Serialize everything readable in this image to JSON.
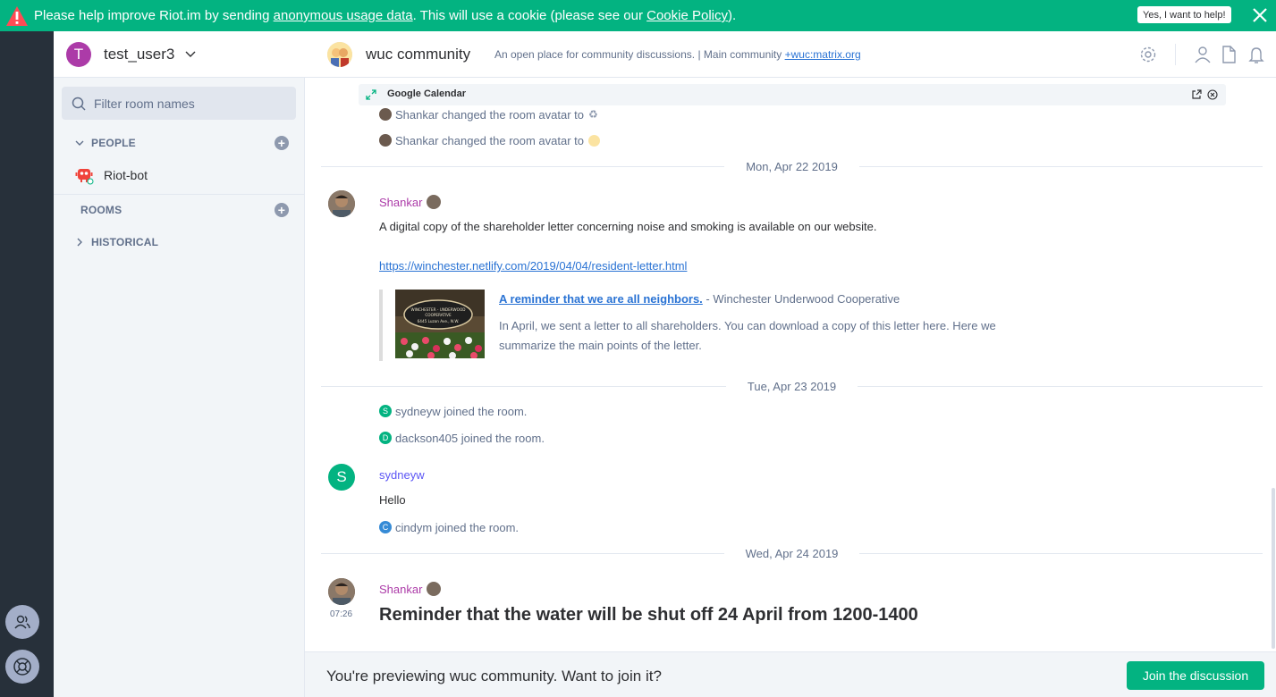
{
  "banner": {
    "prefix": "Please help improve Riot.im by sending ",
    "link1": "anonymous usage data",
    "middle": ". This will use a cookie (please see our ",
    "link2": "Cookie Policy",
    "suffix": ").",
    "yes_label": "Yes, I want to help!",
    "bg_color": "#03b381"
  },
  "user": {
    "initial": "T",
    "name": "test_user3"
  },
  "filter": {
    "placeholder": "Filter room names"
  },
  "sections": {
    "people": "PEOPLE",
    "rooms": "ROOMS",
    "historical": "HISTORICAL",
    "people_items": [
      {
        "label": "Riot-bot"
      }
    ]
  },
  "room": {
    "name": "wuc community",
    "topic_text": "An open place for community discussions. | Main community ",
    "topic_link": "+wuc:matrix.org"
  },
  "widget": {
    "title": "Google Calendar"
  },
  "events": {
    "avatar_change_1": "Shankar changed the room avatar to",
    "avatar_change_2": "Shankar changed the room avatar to",
    "date1": "Mon, Apr 22 2019",
    "msg1_sender": "Shankar",
    "msg1_body": "A digital copy of the shareholder letter concerning noise and smoking is available on our website.",
    "msg1_link": "https://winchester.netlify.com/2019/04/04/resident-letter.html",
    "preview_title": "A reminder that we are all neighbors.",
    "preview_site": " - Winchester Underwood Cooperative",
    "preview_desc": "In April, we sent a letter to all shareholders. You can download a copy of this letter here. Here we summarize the main points of the letter.",
    "preview_sign_line1": "WINCHESTER - UNDERWOOD",
    "preview_sign_line2": "COOPERATIVE",
    "preview_sign_line3": "6445 Luzon Ave., N.W.",
    "date2": "Tue, Apr 23 2019",
    "join1": "sydneyw joined the room.",
    "join1_initial": "S",
    "join2": "dackson405 joined the room.",
    "join2_initial": "D",
    "msg2_sender": "sydneyw",
    "msg2_initial": "S",
    "msg2_body": "Hello",
    "join3": "cindym joined the room.",
    "join3_initial": "C",
    "date3": "Wed, Apr 24 2019",
    "msg3_sender": "Shankar",
    "msg3_time": "07:26",
    "msg3_body": "Reminder that the water will be shut off 24 April from 1200-1400"
  },
  "footer": {
    "message": "You're previewing wuc community. Want to join it?",
    "join_label": "Join the discussion"
  },
  "colors": {
    "accent": "#03b381",
    "link": "#2a73d4",
    "shankar": "#ac3ba8",
    "sydneyw": "#5c56f5",
    "muted": "#61708b"
  }
}
